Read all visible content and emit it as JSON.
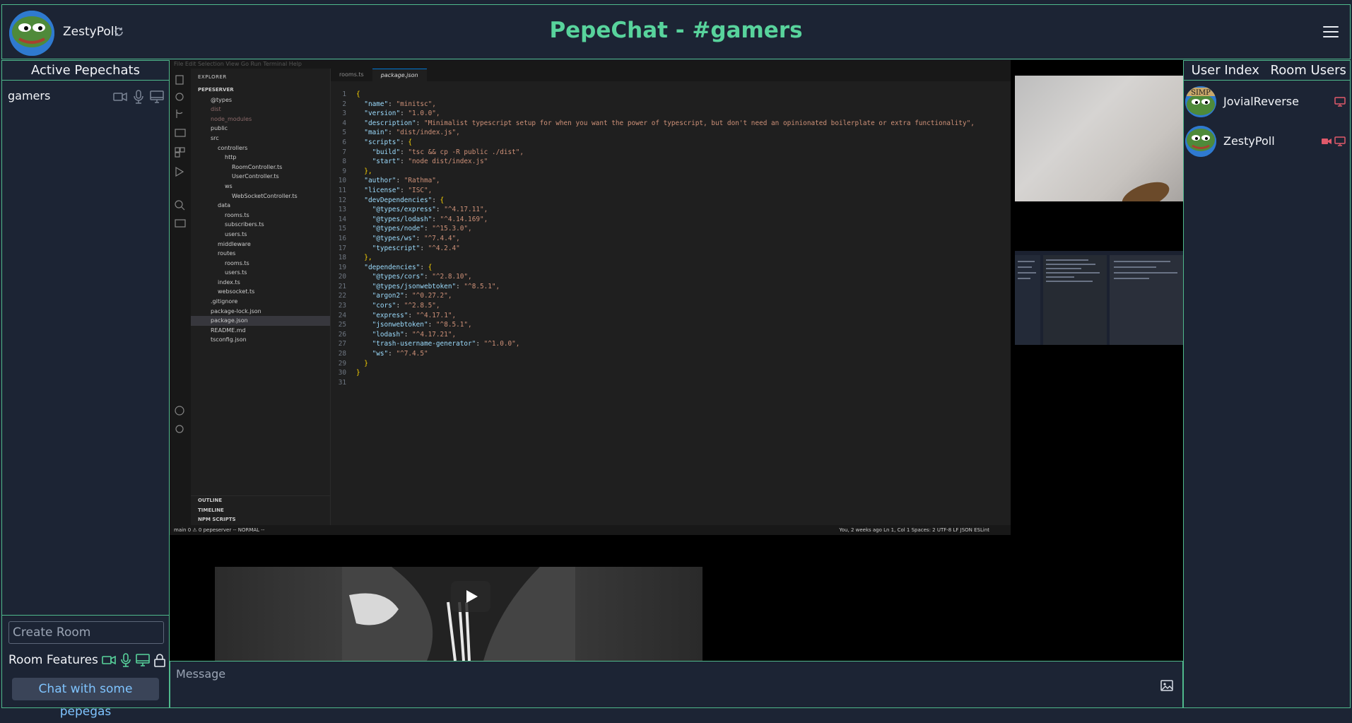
{
  "header": {
    "username": "ZestyPoll",
    "title": "PepeChat - #gamers"
  },
  "left_sidebar": {
    "title": "Active Pepechats",
    "rooms": [
      {
        "name": "gamers"
      }
    ],
    "create_room_placeholder": "Create Room",
    "features_label": "Room Features",
    "chat_button_label": "Chat with some pepegas"
  },
  "right_sidebar": {
    "tabs": [
      "User Index",
      "Room Users"
    ],
    "users": [
      {
        "name": "JovialReverse",
        "avatar_label": "SIMP"
      },
      {
        "name": "ZestyPoll",
        "avatar_label": ""
      }
    ]
  },
  "message_bar": {
    "placeholder": "Message"
  },
  "screen_share": {
    "menu": "File  Edit  Selection  View  Go  Run  Terminal  Help",
    "explorer_title": "EXPLORER",
    "tabs": [
      "rooms.ts",
      "package.json"
    ],
    "tree": [
      "PEPESERVER",
      "@types",
      "dist",
      "node_modules",
      "public",
      "src",
      "controllers",
      "http",
      "RoomController.ts",
      "UserController.ts",
      "ws",
      "WebSocketController.ts",
      "data",
      "rooms.ts",
      "subscribers.ts",
      "users.ts",
      "middleware",
      "routes",
      "rooms.ts",
      "users.ts",
      "index.ts",
      "websocket.ts",
      ".gitignore",
      "package-lock.json",
      "package.json",
      "README.md",
      "tsconfig.json"
    ],
    "panels": [
      "OUTLINE",
      "TIMELINE",
      "NPM SCRIPTS"
    ],
    "status_left": "main   0 ⚠ 0   pepeserver   -- NORMAL --",
    "status_right": "You, 2 weeks ago   Ln 1, Col 1   Spaces: 2   UTF-8   LF   JSON   ESLint",
    "code": [
      "{",
      "  \"name\": \"minitsc\",",
      "  \"version\": \"1.0.0\",",
      "  \"description\": \"Minimalist typescript setup for when you want the power of typescript, but don't need an opinionated boilerplate or extra functionality\",",
      "  \"main\": \"dist/index.js\",",
      "  \"scripts\": {",
      "    \"build\": \"tsc && cp -R public ./dist\",",
      "    \"start\": \"node dist/index.js\"",
      "  },",
      "  \"author\": \"Rathma\",",
      "  \"license\": \"ISC\",",
      "  \"devDependencies\": {",
      "    \"@types/express\": \"^4.17.11\",",
      "    \"@types/lodash\": \"^4.14.169\",",
      "    \"@types/node\": \"^15.3.0\",",
      "    \"@types/ws\": \"^7.4.4\",",
      "    \"typescript\": \"^4.2.4\"",
      "  },",
      "  \"dependencies\": {",
      "    \"@types/cors\": \"^2.8.10\",",
      "    \"@types/jsonwebtoken\": \"^8.5.1\",",
      "    \"argon2\": \"^0.27.2\",",
      "    \"cors\": \"^2.8.5\",",
      "    \"express\": \"^4.17.1\",",
      "    \"jsonwebtoken\": \"^8.5.1\",",
      "    \"lodash\": \"^4.17.21\",",
      "    \"trash-username-generator\": \"^1.0.0\",",
      "    \"ws\": \"^7.4.5\"",
      "  }",
      "}",
      ""
    ]
  },
  "colors": {
    "background": "#1c2434",
    "border": "#4fb98c",
    "title": "#58d39c",
    "link": "#7fc4ff",
    "active_cam": "#e0596a"
  }
}
